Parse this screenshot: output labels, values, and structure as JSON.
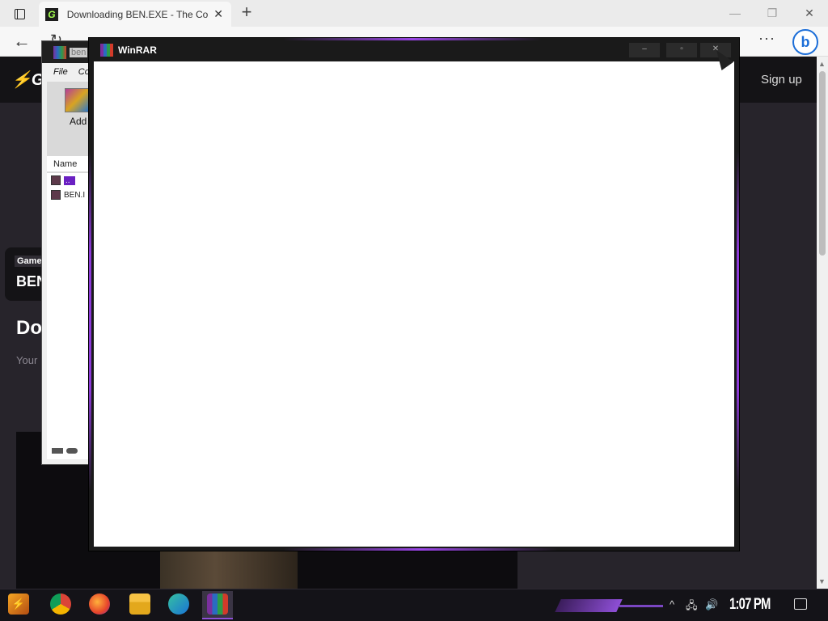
{
  "browser": {
    "tab_title": "Downloading BEN.EXE - The Colle",
    "tab_close": "✕",
    "new_tab": "+",
    "minimize": "—",
    "restore": "❐",
    "close": "✕",
    "back": "←",
    "refresh": "↻",
    "more": "···",
    "bing_label": "b",
    "favicon": "G"
  },
  "site": {
    "logo": "⚡G",
    "signup": "Sign up",
    "game_tag": "Game",
    "game_name": "BEN",
    "heading": "Do",
    "subtext": "Your"
  },
  "winrar_back": {
    "title": "ben",
    "menu_file": "File",
    "menu_co": "Co",
    "add_label": "Add",
    "column_name": "Name",
    "rows": [
      {
        "label": "..",
        "selected": true
      },
      {
        "label": "BEN.I",
        "selected": false
      }
    ]
  },
  "winrar_front": {
    "title": "WinRAR",
    "minimize": "–",
    "maximize": "▫",
    "close": "✕"
  },
  "taskbar": {
    "clock": "1:07 PM",
    "icons": [
      "start-icon",
      "chrome-icon",
      "firefox-icon",
      "file-explorer-icon",
      "edge-icon",
      "winrar-icon"
    ],
    "tray_chevron": "^",
    "tray_network": "🖧",
    "tray_volume": "🔊"
  },
  "colors": {
    "accent_purple": "#8e4fd6",
    "page_bg": "#27242b",
    "header_bg": "#141316"
  }
}
